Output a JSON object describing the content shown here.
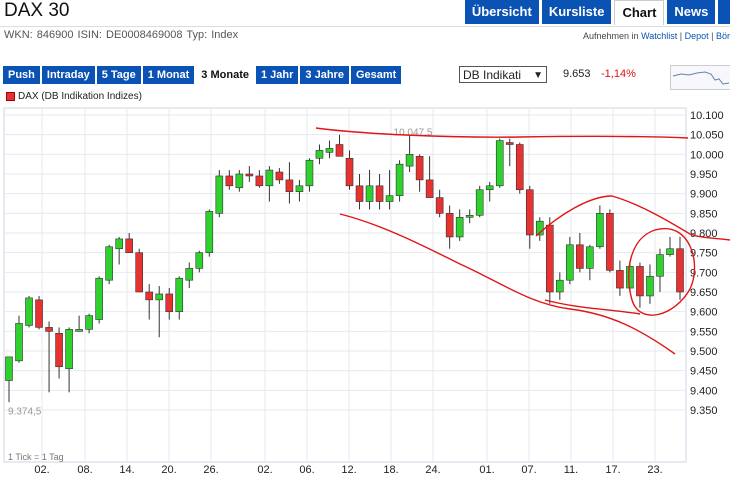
{
  "header": {
    "title": "DAX 30"
  },
  "nav": {
    "tabs": [
      "Übersicht",
      "Kursliste",
      "Chart",
      "News"
    ],
    "active": "Chart"
  },
  "info": {
    "meta": "WKN: 846900   ISIN: DE0008469008   Typ: Index",
    "links_prefix": "Aufnehmen in",
    "watchlist": "Watchlist",
    "depot": "Depot",
    "boerse": "Bör"
  },
  "ranges": {
    "items": [
      "Push",
      "Intraday",
      "5 Tage",
      "1 Monat",
      "3 Monate",
      "1 Jahr",
      "3 Jahre",
      "Gesamt"
    ],
    "active": "3 Monate"
  },
  "source_select": {
    "value": "DB Indikati"
  },
  "quote": {
    "price": "9.653",
    "change": "-1,14%",
    "change_color": "#dd1111"
  },
  "legend": {
    "label": "DAX (DB Indikation Indizes)",
    "color": "#e03434"
  },
  "chart_data": {
    "type": "candlestick",
    "yticks": [
      "10.100",
      "10.050",
      "10.000",
      "9.950",
      "9.900",
      "9.850",
      "9.800",
      "9.750",
      "9.700",
      "9.650",
      "9.600",
      "9.550",
      "9.500",
      "9.450",
      "9.400",
      "9.350"
    ],
    "ylim": [
      9350,
      10100
    ],
    "xticks": [
      "02.",
      "08.",
      "14.",
      "20.",
      "26.",
      "02.",
      "06.",
      "12.",
      "18.",
      "24.",
      "01.",
      "07.",
      "11.",
      "17.",
      "23."
    ],
    "high_label": "10.047,5",
    "low_label": "9.374,5",
    "footnote": "1 Tick = 1 Tag",
    "up_color": "#2fd12f",
    "down_color": "#e83131",
    "candles": [
      {
        "o": 9425,
        "h": 9450,
        "l": 9370,
        "c": 9485
      },
      {
        "o": 9475,
        "h": 9590,
        "l": 9470,
        "c": 9570
      },
      {
        "o": 9565,
        "h": 9640,
        "l": 9560,
        "c": 9635
      },
      {
        "o": 9630,
        "h": 9640,
        "l": 9555,
        "c": 9560
      },
      {
        "o": 9560,
        "h": 9575,
        "l": 9395,
        "c": 9550
      },
      {
        "o": 9545,
        "h": 9560,
        "l": 9430,
        "c": 9460
      },
      {
        "o": 9455,
        "h": 9560,
        "l": 9395,
        "c": 9555
      },
      {
        "o": 9550,
        "h": 9590,
        "l": 9550,
        "c": 9555
      },
      {
        "o": 9555,
        "h": 9595,
        "l": 9545,
        "c": 9590
      },
      {
        "o": 9580,
        "h": 9690,
        "l": 9570,
        "c": 9685
      },
      {
        "o": 9680,
        "h": 9770,
        "l": 9670,
        "c": 9765
      },
      {
        "o": 9760,
        "h": 9790,
        "l": 9720,
        "c": 9785
      },
      {
        "o": 9785,
        "h": 9800,
        "l": 9755,
        "c": 9750
      },
      {
        "o": 9750,
        "h": 9760,
        "l": 9660,
        "c": 9650
      },
      {
        "o": 9650,
        "h": 9670,
        "l": 9580,
        "c": 9630
      },
      {
        "o": 9630,
        "h": 9665,
        "l": 9535,
        "c": 9645
      },
      {
        "o": 9645,
        "h": 9660,
        "l": 9580,
        "c": 9600
      },
      {
        "o": 9600,
        "h": 9690,
        "l": 9580,
        "c": 9685
      },
      {
        "o": 9680,
        "h": 9725,
        "l": 9660,
        "c": 9710
      },
      {
        "o": 9710,
        "h": 9755,
        "l": 9700,
        "c": 9750
      },
      {
        "o": 9750,
        "h": 9860,
        "l": 9740,
        "c": 9855
      },
      {
        "o": 9850,
        "h": 9960,
        "l": 9840,
        "c": 9945
      },
      {
        "o": 9945,
        "h": 9960,
        "l": 9910,
        "c": 9920
      },
      {
        "o": 9915,
        "h": 9960,
        "l": 9905,
        "c": 9950
      },
      {
        "o": 9950,
        "h": 9970,
        "l": 9930,
        "c": 9945
      },
      {
        "o": 9945,
        "h": 9960,
        "l": 9915,
        "c": 9920
      },
      {
        "o": 9920,
        "h": 9970,
        "l": 9880,
        "c": 9960
      },
      {
        "o": 9955,
        "h": 9965,
        "l": 9925,
        "c": 9935
      },
      {
        "o": 9935,
        "h": 9980,
        "l": 9875,
        "c": 9905
      },
      {
        "o": 9905,
        "h": 9935,
        "l": 9880,
        "c": 9920
      },
      {
        "o": 9920,
        "h": 9990,
        "l": 9905,
        "c": 9985
      },
      {
        "o": 9990,
        "h": 10025,
        "l": 9975,
        "c": 10010
      },
      {
        "o": 10005,
        "h": 10035,
        "l": 9990,
        "c": 10015
      },
      {
        "o": 10025,
        "h": 10050,
        "l": 10000,
        "c": 9995
      },
      {
        "o": 9990,
        "h": 10010,
        "l": 9910,
        "c": 9920
      },
      {
        "o": 9920,
        "h": 9950,
        "l": 9860,
        "c": 9880
      },
      {
        "o": 9880,
        "h": 9960,
        "l": 9860,
        "c": 9920
      },
      {
        "o": 9920,
        "h": 9950,
        "l": 9860,
        "c": 9880
      },
      {
        "o": 9880,
        "h": 9960,
        "l": 9860,
        "c": 9895
      },
      {
        "o": 9895,
        "h": 9985,
        "l": 9880,
        "c": 9975
      },
      {
        "o": 9970,
        "h": 10050,
        "l": 9955,
        "c": 10000
      },
      {
        "o": 9995,
        "h": 10000,
        "l": 9905,
        "c": 9935
      },
      {
        "o": 9935,
        "h": 9995,
        "l": 9900,
        "c": 9890
      },
      {
        "o": 9890,
        "h": 9910,
        "l": 9840,
        "c": 9850
      },
      {
        "o": 9850,
        "h": 9870,
        "l": 9760,
        "c": 9790
      },
      {
        "o": 9790,
        "h": 9860,
        "l": 9780,
        "c": 9840
      },
      {
        "o": 9840,
        "h": 9860,
        "l": 9825,
        "c": 9845
      },
      {
        "o": 9845,
        "h": 9920,
        "l": 9840,
        "c": 9910
      },
      {
        "o": 9910,
        "h": 9930,
        "l": 9880,
        "c": 9920
      },
      {
        "o": 9920,
        "h": 10040,
        "l": 9915,
        "c": 10035
      },
      {
        "o": 10030,
        "h": 10040,
        "l": 9970,
        "c": 10025
      },
      {
        "o": 10025,
        "h": 10030,
        "l": 9900,
        "c": 9910
      },
      {
        "o": 9910,
        "h": 9920,
        "l": 9760,
        "c": 9795
      },
      {
        "o": 9795,
        "h": 9840,
        "l": 9780,
        "c": 9830
      },
      {
        "o": 9820,
        "h": 9840,
        "l": 9620,
        "c": 9650
      },
      {
        "o": 9650,
        "h": 9700,
        "l": 9630,
        "c": 9680
      },
      {
        "o": 9680,
        "h": 9790,
        "l": 9670,
        "c": 9770
      },
      {
        "o": 9770,
        "h": 9800,
        "l": 9700,
        "c": 9710
      },
      {
        "o": 9710,
        "h": 9770,
        "l": 9680,
        "c": 9765
      },
      {
        "o": 9765,
        "h": 9870,
        "l": 9760,
        "c": 9850
      },
      {
        "o": 9850,
        "h": 9860,
        "l": 9700,
        "c": 9705
      },
      {
        "o": 9705,
        "h": 9730,
        "l": 9640,
        "c": 9660
      },
      {
        "o": 9660,
        "h": 9730,
        "l": 9650,
        "c": 9715
      },
      {
        "o": 9715,
        "h": 9725,
        "l": 9610,
        "c": 9640
      },
      {
        "o": 9640,
        "h": 9720,
        "l": 9620,
        "c": 9690
      },
      {
        "o": 9690,
        "h": 9760,
        "l": 9650,
        "c": 9745
      },
      {
        "o": 9745,
        "h": 9790,
        "l": 9740,
        "c": 9760
      },
      {
        "o": 9760,
        "h": 9790,
        "l": 9630,
        "c": 9650
      }
    ]
  }
}
